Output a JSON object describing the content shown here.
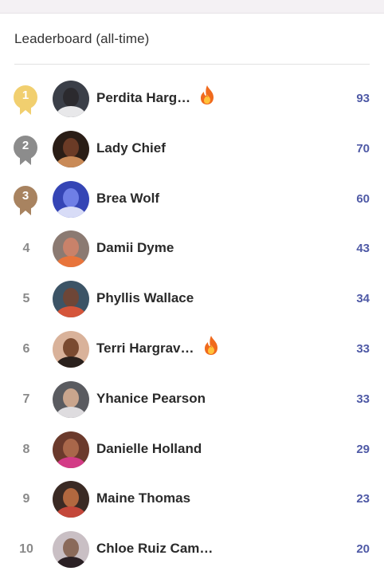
{
  "header": {
    "title": "Leaderboard (all-time)"
  },
  "colors": {
    "gold": "#f1cf6f",
    "silver": "#8c8c8c",
    "bronze": "#a88360",
    "score": "#4f5aa6",
    "fire": "#f06a1d"
  },
  "leaderboard": [
    {
      "rank": "1",
      "name": "Perdita Harg…",
      "score": "93",
      "medal": "gold",
      "fire": true,
      "avatar": [
        "#3b3f48",
        "#2b2a2e",
        "#e8e8ea"
      ]
    },
    {
      "rank": "2",
      "name": "Lady Chief",
      "score": "70",
      "medal": "silver",
      "fire": false,
      "avatar": [
        "#2a1d16",
        "#6b3b26",
        "#c98a57"
      ]
    },
    {
      "rank": "3",
      "name": "Brea Wolf",
      "score": "60",
      "medal": "bronze",
      "fire": false,
      "avatar": [
        "#3545b5",
        "#6f7fe6",
        "#d8dcf7"
      ]
    },
    {
      "rank": "4",
      "name": "Damii Dyme",
      "score": "43",
      "medal": "",
      "fire": false,
      "avatar": [
        "#8b7a72",
        "#c9826a",
        "#e8743b"
      ]
    },
    {
      "rank": "5",
      "name": "Phyllis Wallace",
      "score": "34",
      "medal": "",
      "fire": false,
      "avatar": [
        "#3c5466",
        "#6e4637",
        "#d5553a"
      ]
    },
    {
      "rank": "6",
      "name": "Terri Hargrav…",
      "score": "33",
      "medal": "",
      "fire": true,
      "avatar": [
        "#d9b29a",
        "#7a4a30",
        "#2a201c"
      ]
    },
    {
      "rank": "7",
      "name": "Yhanice Pearson",
      "score": "33",
      "medal": "",
      "fire": false,
      "avatar": [
        "#5a5b60",
        "#c9a58d",
        "#dedcdf"
      ]
    },
    {
      "rank": "8",
      "name": "Danielle Holland",
      "score": "29",
      "medal": "",
      "fire": false,
      "avatar": [
        "#6b3a2c",
        "#a9674a",
        "#d33b86"
      ]
    },
    {
      "rank": "9",
      "name": "Maine Thomas",
      "score": "23",
      "medal": "",
      "fire": false,
      "avatar": [
        "#3a2a24",
        "#b2683f",
        "#c4473a"
      ]
    },
    {
      "rank": "10",
      "name": "Chloe Ruiz Cam…",
      "score": "20",
      "medal": "",
      "fire": false,
      "avatar": [
        "#c9bfc4",
        "#8a6a5a",
        "#2a2024"
      ]
    }
  ]
}
